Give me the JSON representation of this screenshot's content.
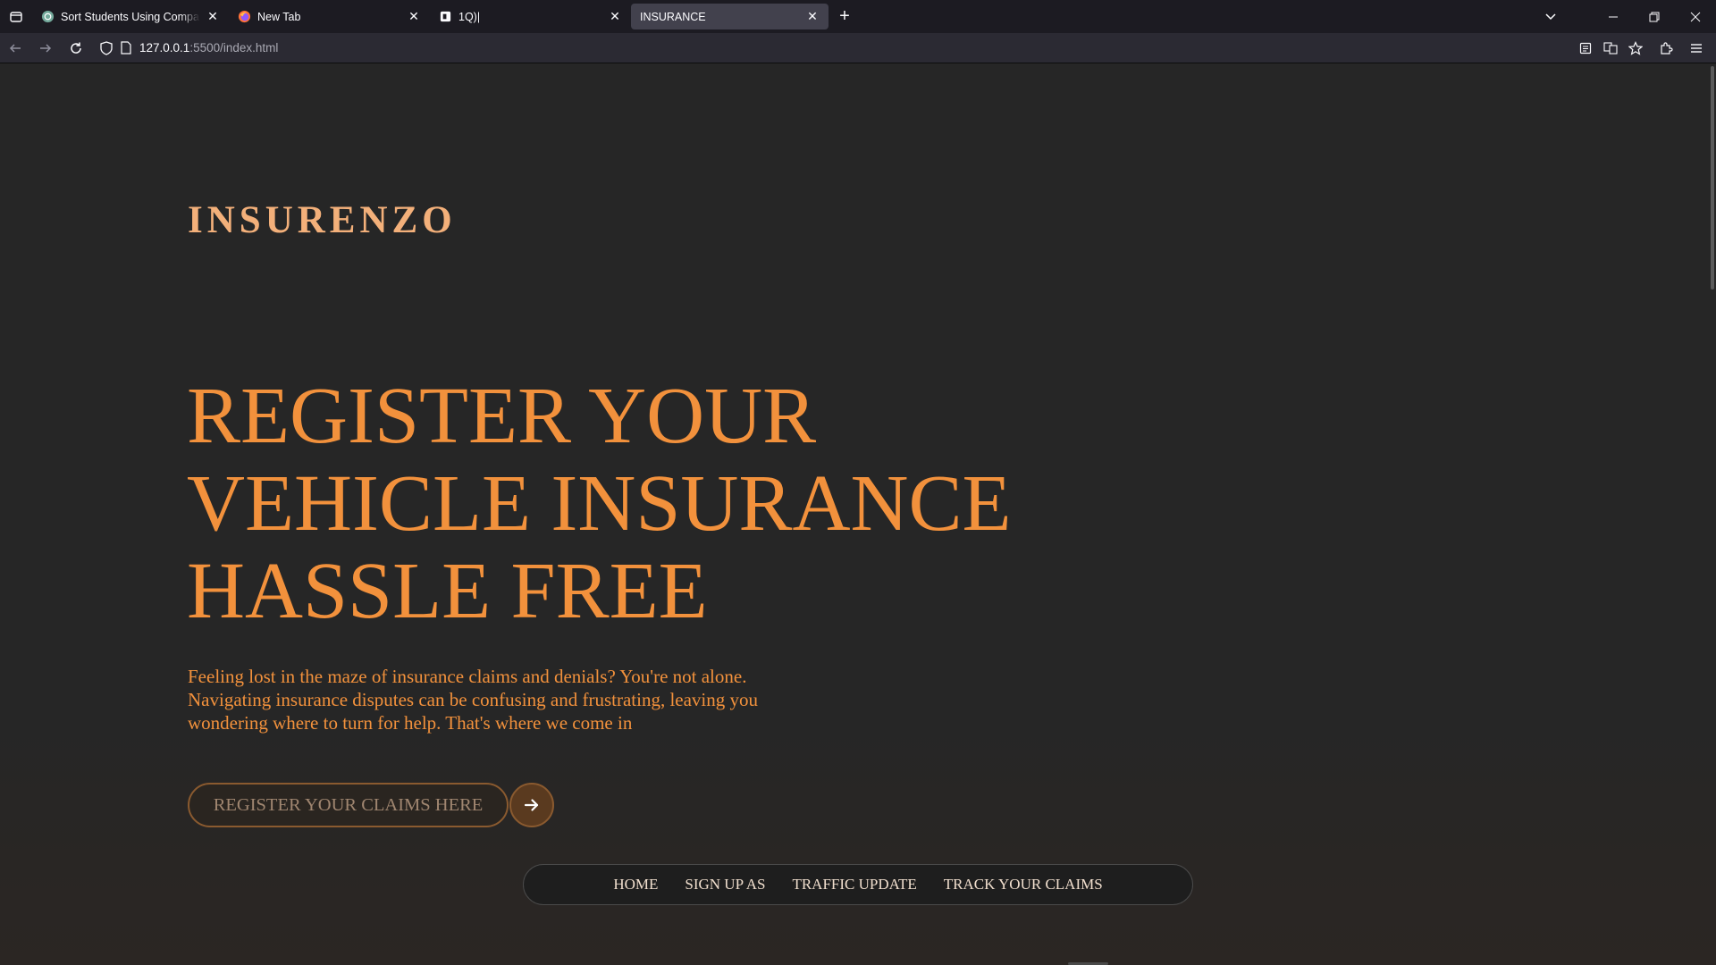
{
  "browser": {
    "tabs": [
      {
        "title": "Sort Students Using Comparato",
        "icon": "chatgpt-icon",
        "active": false
      },
      {
        "title": "New Tab",
        "icon": "firefox-icon",
        "active": false
      },
      {
        "title": "1Q)|",
        "icon": "replit-icon",
        "active": false
      },
      {
        "title": "INSURANCE",
        "icon": "none",
        "active": true
      }
    ],
    "url_host": "127.0.0.1",
    "url_path": ":5500/index.html"
  },
  "page": {
    "brand": "INSURENZO",
    "hero_lines": [
      "REGISTER YOUR",
      "VEHICLE INSURANCE",
      "HASSLE FREE"
    ],
    "description": "Feeling lost in the maze of insurance claims and denials? You're not alone. Navigating insurance disputes can be confusing and frustrating, leaving you wondering where to turn for help. That's where we come in",
    "cta_label": "REGISTER YOUR CLAIMS HERE",
    "nav_links": [
      "HOME",
      "SIGN UP AS",
      "TRAFFIC UPDATE",
      "TRACK YOUR CLAIMS"
    ]
  },
  "colors": {
    "accent": "#f2913c",
    "brand": "#f3b07a",
    "background": "#262626",
    "nav_text": "#f1dfce"
  }
}
